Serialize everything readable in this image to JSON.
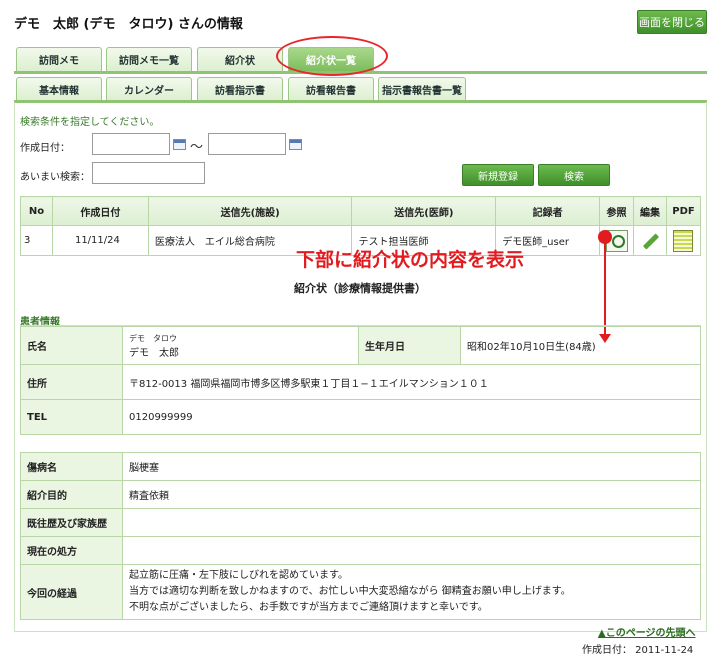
{
  "page": {
    "title": "デモ　太郎 (デモ　タロウ) さんの情報",
    "close_label": "画面を閉じる"
  },
  "tabs_row1": [
    "訪問メモ",
    "訪問メモ一覧",
    "紹介状",
    "紹介状一覧"
  ],
  "tabs_row2": [
    "基本情報",
    "カレンダー",
    "訪看指示書",
    "訪看報告書",
    "指示書報告書一覧"
  ],
  "search": {
    "hint": "検索条件を指定してください。",
    "date_label": "作成日付：",
    "tilde": "〜",
    "fuzzy_label": "あいまい検索：",
    "new_label": "新規登録",
    "search_label": "検索"
  },
  "table": {
    "headers": [
      "No",
      "作成日付",
      "送信先(施設)",
      "送信先(医師)",
      "記録者",
      "参照",
      "編集",
      "PDF"
    ],
    "rows": [
      {
        "no": "3",
        "date": "11/11/24",
        "facility": "医療法人　エイル総合病院",
        "doctor": "テスト担当医師",
        "recorder": "デモ医師_user"
      }
    ]
  },
  "annotation": "下部に紹介状の内容を表示",
  "document": {
    "title": "紹介状（診療情報提供書）",
    "patient_section": "患者情報",
    "name_label": "氏名",
    "name_kana": "デモ　タロウ",
    "name": "デモ　太郎",
    "birth_label": "生年月日",
    "birth": "昭和02年10月10日生(84歳)",
    "address_label": "住所",
    "address": "〒812-0013 福岡県福岡市博多区博多駅東１丁目１−１エイルマンション１０１",
    "tel_label": "TEL",
    "tel": "0120999999",
    "disease_label": "傷病名",
    "disease": "脳梗塞",
    "purpose_label": "紹介目的",
    "purpose": "精査依頼",
    "history_label": "既往歴及び家族歴",
    "history": "",
    "prescription_label": "現在の処方",
    "prescription": "",
    "progress_label": "今回の経過",
    "progress_lines": [
      "起立筋に圧痛・左下肢にしびれを認めています。",
      "当方では適切な判断を致しかねますので、お忙しい中大変恐縮ながら 御精査お願い申し上げます。",
      "不明な点がございましたら、お手数ですが当方までご連絡頂けますと幸いです。"
    ]
  },
  "footer": {
    "top_link": "▲このページの先頭へ",
    "created": "作成日付： 2011-11-24"
  },
  "colors": {
    "accent": "#4a9b33",
    "annotation": "#e21b1f"
  }
}
